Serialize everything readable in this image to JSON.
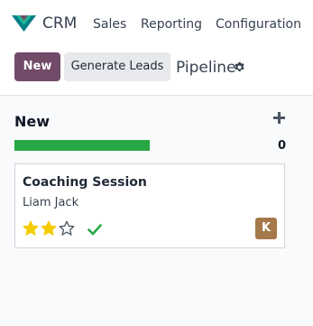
{
  "navbar": {
    "app_name": "CRM",
    "items": [
      "Sales",
      "Reporting",
      "Configuration"
    ]
  },
  "control_panel": {
    "new_label": "New",
    "generate_leads_label": "Generate Leads",
    "breadcrumb_title": "Pipeline"
  },
  "column": {
    "title": "New",
    "count": "0",
    "progress_fraction": 1.0
  },
  "card": {
    "title": "Coaching Session",
    "subtitle": "Liam Jack",
    "priority_stars": 2,
    "priority_max": 3,
    "avatar_initial": "K"
  },
  "colors": {
    "brand": "#714b67",
    "progress": "#28a745",
    "star_filled": "#f3cc00",
    "check": "#28a745",
    "avatar_bg": "#a5794a"
  },
  "icons": [
    "app-logo-icon",
    "gear-icon",
    "plus-icon",
    "star-icon",
    "check-icon"
  ]
}
